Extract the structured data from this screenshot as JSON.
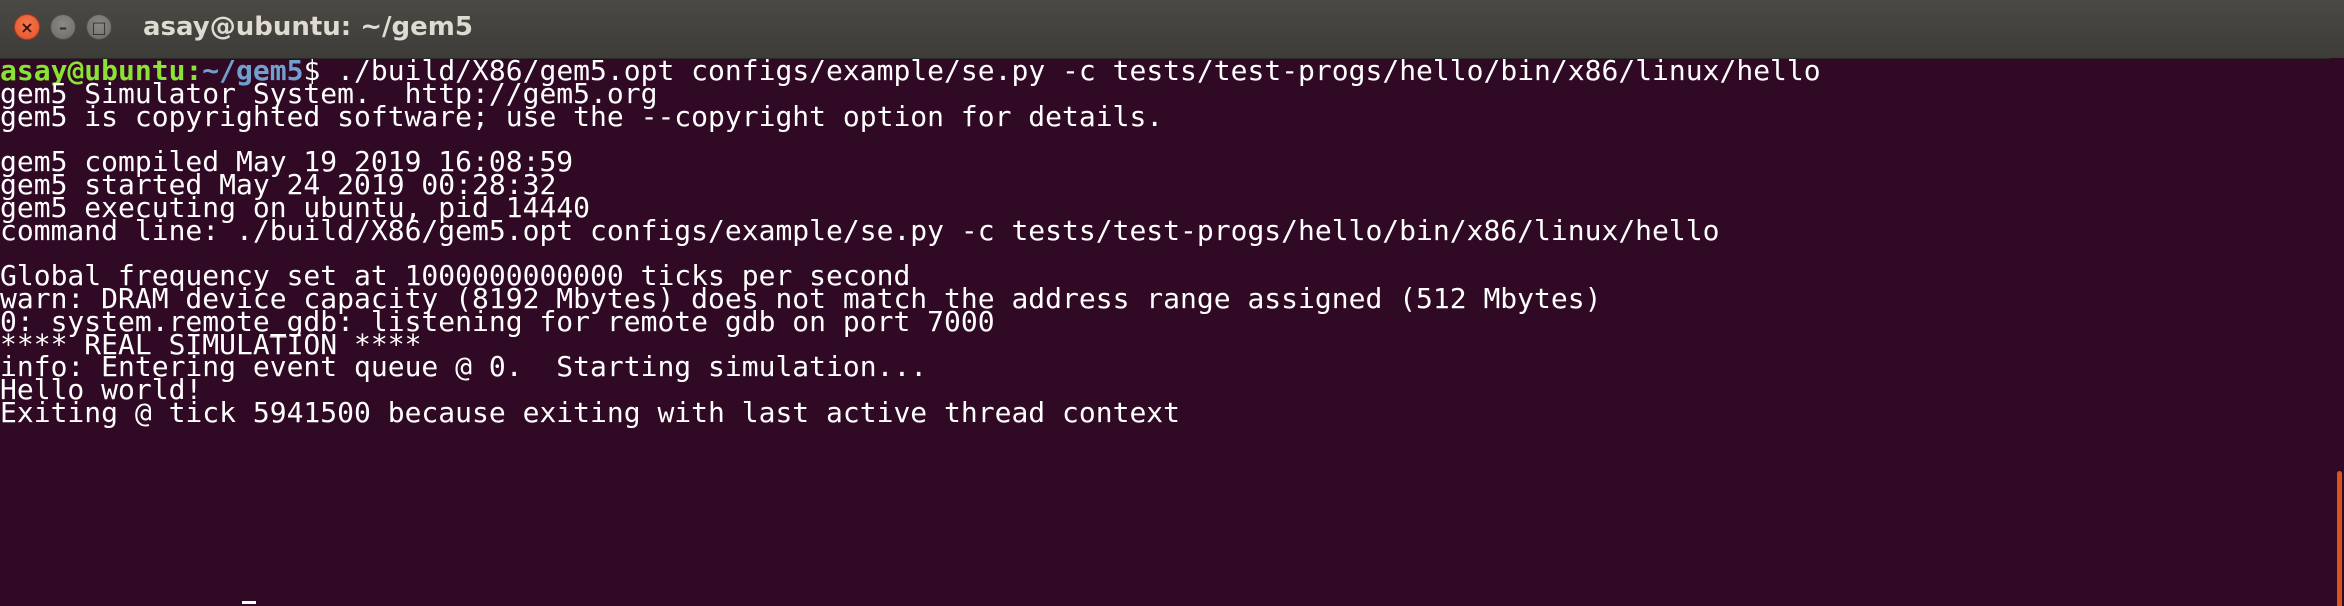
{
  "window": {
    "title": "asay@ubuntu: ~/gem5",
    "close_glyph": "×",
    "minimize_glyph": "–",
    "maximize_glyph": "□"
  },
  "terminal": {
    "prompt_user": "asay@ubuntu",
    "prompt_sep": ":",
    "prompt_path": "~/gem5",
    "prompt_symbol": "$ ",
    "command": "./build/X86/gem5.opt configs/example/se.py -c tests/test-progs/hello/bin/x86/linux/hello",
    "output": [
      "gem5 Simulator System.  http://gem5.org",
      "gem5 is copyrighted software; use the --copyright option for details.",
      "",
      "gem5 compiled May 19 2019 16:08:59",
      "gem5 started May 24 2019 00:28:32",
      "gem5 executing on ubuntu, pid 14440",
      "command line: ./build/X86/gem5.opt configs/example/se.py -c tests/test-progs/hello/bin/x86/linux/hello",
      "",
      "Global frequency set at 1000000000000 ticks per second",
      "warn: DRAM device capacity (8192 Mbytes) does not match the address range assigned (512 Mbytes)",
      "0: system.remote_gdb: listening for remote gdb on port 7000",
      "**** REAL SIMULATION ****",
      "info: Entering event queue @ 0.  Starting simulation...",
      "Hello world!",
      "Exiting @ tick 5941500 because exiting with last active thread context"
    ]
  },
  "colors": {
    "background": "#300a24",
    "prompt_user": "#8ae234",
    "prompt_path": "#729fcf",
    "text": "#ffffff",
    "scroll_thumb": "#d9531e"
  }
}
